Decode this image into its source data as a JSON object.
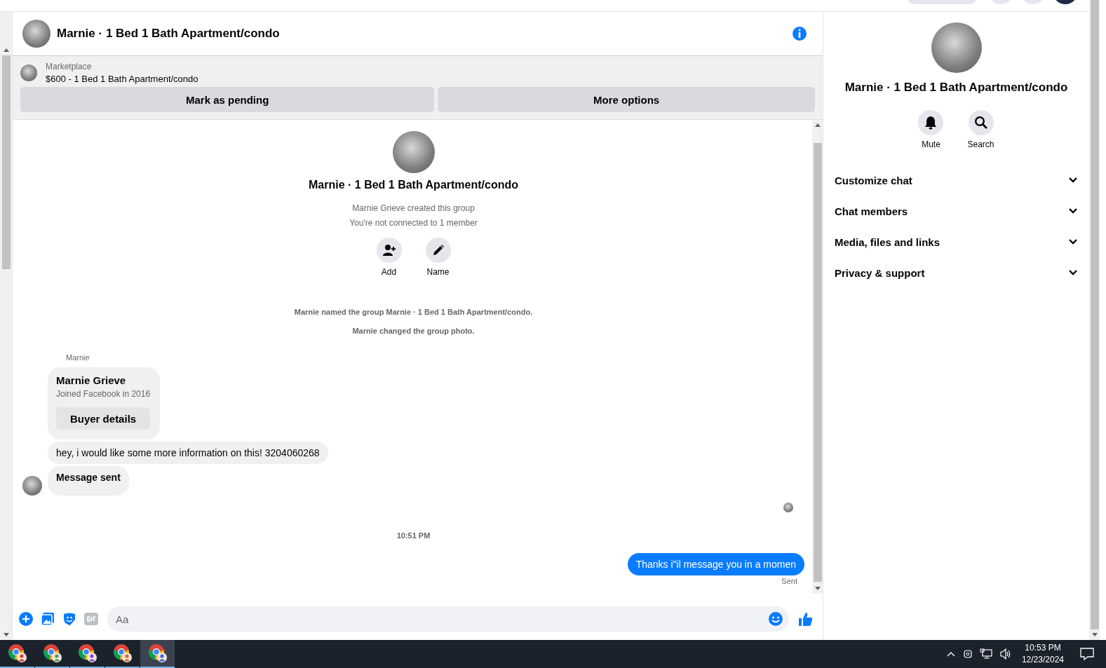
{
  "conversation": {
    "title": "Marnie · 1 Bed 1 Bath Apartment/condo"
  },
  "listing": {
    "source": "Marketplace",
    "title": "$600 - 1 Bed 1 Bath Apartment/condo",
    "actions": [
      "Mark as pending",
      "More options"
    ]
  },
  "group_intro": {
    "title": "Marnie · 1 Bed 1 Bath Apartment/condo",
    "lines": [
      "Marnie Grieve created this group",
      "You're not connected to 1 member"
    ],
    "actions": [
      {
        "kind": "add",
        "label": "Add"
      },
      {
        "kind": "name",
        "label": "Name"
      }
    ]
  },
  "events": [
    "Marnie named the group Marnie · 1 Bed 1 Bath Apartment/condo.",
    "Marnie changed the group photo."
  ],
  "thread": [
    {
      "kind": "sender",
      "text": "Marnie"
    },
    {
      "kind": "profile_card",
      "name": "Marnie Grieve",
      "detail": "Joined Facebook in 2016",
      "action": "Buyer details"
    },
    {
      "kind": "incoming",
      "text": "hey, i would like some more information on this! 3204060268"
    },
    {
      "kind": "notice",
      "text": "Message sent"
    },
    {
      "kind": "read_receipt"
    },
    {
      "kind": "timestamp",
      "text": "10:51 PM"
    },
    {
      "kind": "outgoing",
      "text": "Thanks i\"il message you in a momen"
    },
    {
      "kind": "status",
      "text": "Sent"
    }
  ],
  "composer": {
    "placeholder": "Aa"
  },
  "details_panel": {
    "title": "Marnie · 1 Bed 1 Bath Apartment/condo",
    "actions": [
      {
        "kind": "mute",
        "label": "Mute"
      },
      {
        "kind": "search",
        "label": "Search"
      }
    ],
    "sections": [
      {
        "label": "Customize chat",
        "expanded": false
      },
      {
        "label": "Chat members",
        "expanded": false
      },
      {
        "label": "Media, files and links",
        "expanded": false
      },
      {
        "label": "Privacy & support",
        "expanded": false
      }
    ]
  },
  "taskbar": {
    "apps": [
      {
        "color": "#e0402a",
        "selected": false
      },
      {
        "color": "#5a9a5a",
        "selected": false
      },
      {
        "color": "#8a4ac8",
        "selected": false
      },
      {
        "color": "#e06a2a",
        "selected": false
      },
      {
        "color": "#3a6ad8",
        "selected": true
      }
    ],
    "time": "10:53 PM",
    "date": "12/23/2024"
  }
}
